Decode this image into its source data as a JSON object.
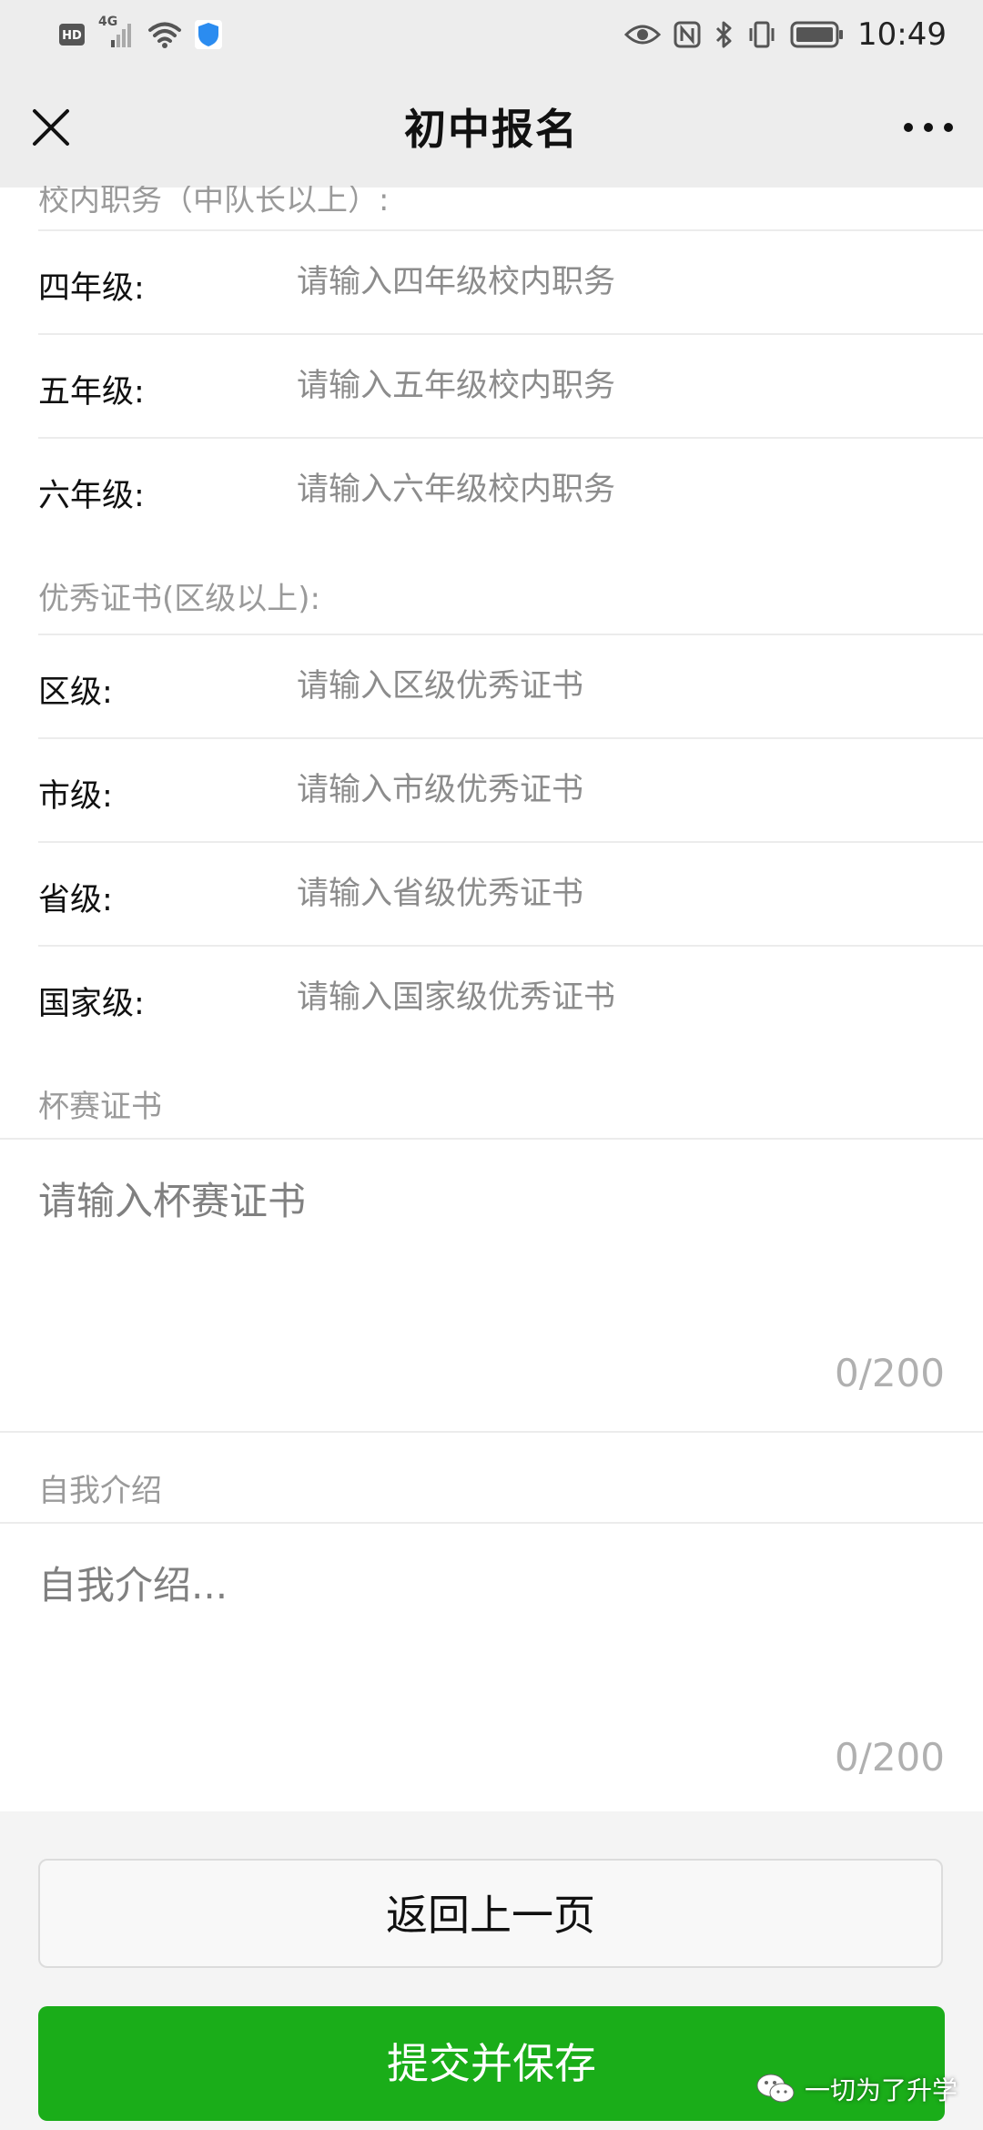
{
  "status_bar": {
    "hd_badge": "HD",
    "network": "4G",
    "time": "10:49",
    "icons": [
      "hd-icon",
      "signal-icon",
      "wifi-icon",
      "shield-icon",
      "eye-icon",
      "nfc-icon",
      "bluetooth-icon",
      "vibrate-icon",
      "battery-icon"
    ]
  },
  "nav": {
    "title": "初中报名",
    "close_icon": "close-icon",
    "more_icon": "more-icon"
  },
  "duties": {
    "section_label": "校内职务（中队长以上）:",
    "rows": [
      {
        "label": "四年级:",
        "placeholder": "请输入四年级校内职务"
      },
      {
        "label": "五年级:",
        "placeholder": "请输入五年级校内职务"
      },
      {
        "label": "六年级:",
        "placeholder": "请输入六年级校内职务"
      }
    ]
  },
  "certificates": {
    "section_label": "优秀证书(区级以上):",
    "rows": [
      {
        "label": "区级:",
        "placeholder": "请输入区级优秀证书"
      },
      {
        "label": "市级:",
        "placeholder": "请输入市级优秀证书"
      },
      {
        "label": "省级:",
        "placeholder": "请输入省级优秀证书"
      },
      {
        "label": "国家级:",
        "placeholder": "请输入国家级优秀证书"
      }
    ]
  },
  "cup": {
    "section_label": "杯赛证书",
    "placeholder": "请输入杯赛证书",
    "counter": "0/200"
  },
  "intro": {
    "section_label": "自我介绍",
    "placeholder": "自我介绍...",
    "counter": "0/200"
  },
  "buttons": {
    "back_label": "返回上一页",
    "submit_label": "提交并保存",
    "submit_color": "#1aad19"
  },
  "watermark": {
    "text": "一切为了升学",
    "icon": "wechat-icon"
  }
}
